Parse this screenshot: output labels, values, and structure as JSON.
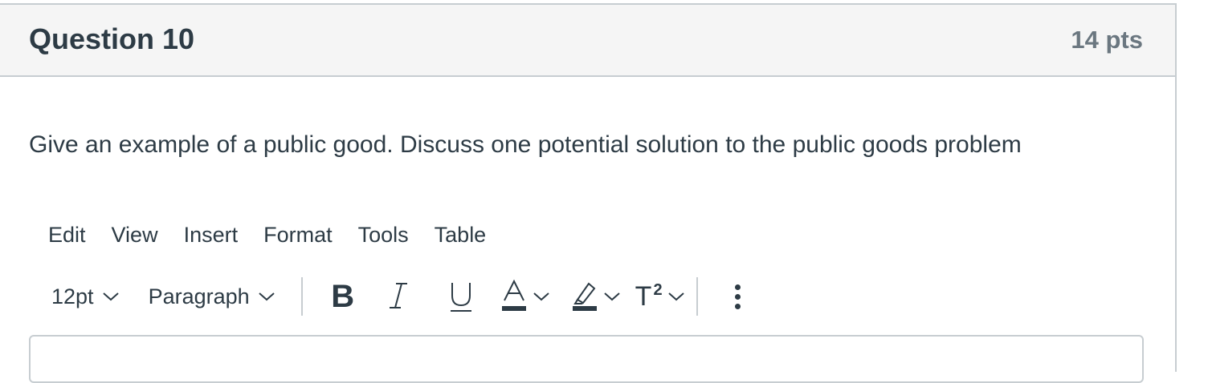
{
  "question": {
    "title": "Question 10",
    "points": "14 pts",
    "text": "Give an example of a public good. Discuss one potential solution to the public goods problem"
  },
  "menubar": {
    "items": [
      "Edit",
      "View",
      "Insert",
      "Format",
      "Tools",
      "Table"
    ]
  },
  "toolbar": {
    "font_size": "12pt",
    "block_format": "Paragraph",
    "icons": {
      "bold": "B",
      "italic": "I",
      "underline": "U",
      "text_color": "A",
      "superscript": "T",
      "superscript_mark": "2"
    }
  },
  "colors": {
    "text": "#2d3b45",
    "muted": "#6b7780",
    "border": "#c7cdd1",
    "header_bg": "#f5f5f5"
  }
}
